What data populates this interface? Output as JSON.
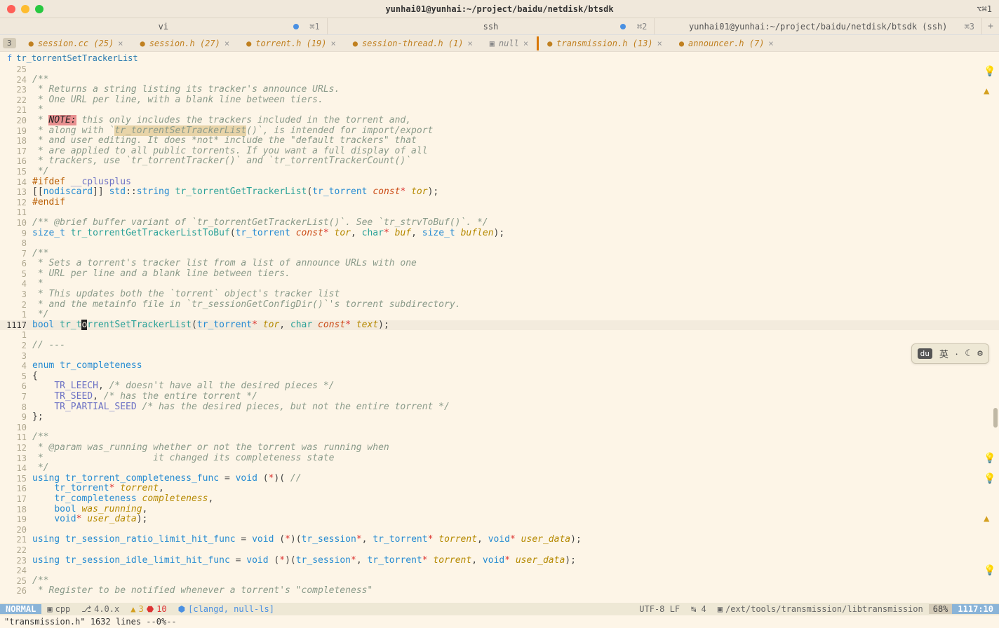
{
  "window": {
    "title": "yunhai01@yunhai:~/project/baidu/netdisk/btsdk",
    "shortcut_right": "⌥⌘1"
  },
  "tmux": [
    {
      "label": "vi",
      "shortcut": "⌘1",
      "activity": true
    },
    {
      "label": "ssh",
      "shortcut": "⌘2",
      "activity": true
    },
    {
      "label": "yunhai01@yunhai:~/project/baidu/netdisk/btsdk (ssh)",
      "shortcut": "⌘3",
      "activity": false
    }
  ],
  "buffers": {
    "count_badge": "3",
    "tabs": [
      {
        "name": "session.cc (25)",
        "modified": true
      },
      {
        "name": "session.h (27)",
        "modified": true
      },
      {
        "name": "torrent.h (19)",
        "modified": true
      },
      {
        "name": "session-thread.h (1)",
        "modified": true
      },
      {
        "name": "null",
        "modified": false,
        "null": true
      },
      {
        "name": "transmission.h (13)",
        "modified": true,
        "active": true
      },
      {
        "name": "announcer.h (7)",
        "modified": true
      }
    ]
  },
  "context": {
    "icon": "f",
    "path": "tr_torrentSetTrackerList"
  },
  "code": [
    {
      "n": "25",
      "t": ""
    },
    {
      "n": "24",
      "t": "/**",
      "cls": "c-comment"
    },
    {
      "n": "23",
      "t": " * Returns a string listing its tracker's announce URLs.",
      "cls": "c-comment"
    },
    {
      "n": "22",
      "t": " * One URL per line, with a blank line between tiers.",
      "cls": "c-comment"
    },
    {
      "n": "21",
      "t": " *",
      "cls": "c-comment"
    },
    {
      "n": "20",
      "html": "<span class='c-comment'> * </span><span class='c-note'>NOTE:</span><span class='c-comment'> this only includes the trackers included in the torrent and,</span>"
    },
    {
      "n": "19",
      "html": "<span class='c-comment'> * along with `</span><span class='c-hl c-comment'>tr_torrentSetTrackerList</span><span class='c-comment'>()`, is intended for import/export</span>"
    },
    {
      "n": "18",
      "t": " * and user editing. It does *not* include the \"default trackers\" that",
      "cls": "c-comment"
    },
    {
      "n": "17",
      "t": " * are applied to all public torrents. If you want a full display of all",
      "cls": "c-comment"
    },
    {
      "n": "16",
      "t": " * trackers, use `tr_torrentTracker()` and `tr_torrentTrackerCount()`",
      "cls": "c-comment"
    },
    {
      "n": "15",
      "t": " */",
      "cls": "c-comment"
    },
    {
      "n": "14",
      "html": "<span class='c-pp'>#ifdef</span> <span class='c-pp2'>__cplusplus</span>"
    },
    {
      "n": "13",
      "html": "[[<span class='c-id'>nodiscard</span>]] <span class='c-type'>std</span>::<span class='c-type'>string</span> <span class='c-fn'>tr_torrentGetTrackerList</span>(<span class='c-type'>tr_torrent</span> <span class='c-const'>const</span><span class='c-ptr'>*</span> <span class='c-param'>tor</span>);"
    },
    {
      "n": "12",
      "html": "<span class='c-pp'>#endif</span>"
    },
    {
      "n": "11",
      "t": ""
    },
    {
      "n": "10",
      "t": "/** @brief buffer variant of `tr_torrentGetTrackerList()`. See `tr_strvToBuf()`. */",
      "cls": "c-comment"
    },
    {
      "n": "9",
      "html": "<span class='c-type'>size_t</span> <span class='c-fn'>tr_torrentGetTrackerListToBuf</span>(<span class='c-type'>tr_torrent</span> <span class='c-const'>const</span><span class='c-ptr'>*</span> <span class='c-param'>tor</span>, <span class='c-char'>char</span><span class='c-ptr'>*</span> <span class='c-param'>buf</span>, <span class='c-type'>size_t</span> <span class='c-param'>buflen</span>);"
    },
    {
      "n": "8",
      "t": ""
    },
    {
      "n": "7",
      "t": "/**",
      "cls": "c-comment"
    },
    {
      "n": "6",
      "t": " * Sets a torrent's tracker list from a list of announce URLs with one",
      "cls": "c-comment"
    },
    {
      "n": "5",
      "t": " * URL per line and a blank line between tiers.",
      "cls": "c-comment"
    },
    {
      "n": "4",
      "t": " *",
      "cls": "c-comment"
    },
    {
      "n": "3",
      "t": " * This updates both the `torrent` object's tracker list",
      "cls": "c-comment"
    },
    {
      "n": "2",
      "t": " * and the metainfo file in `tr_sessionGetConfigDir()`'s torrent subdirectory.",
      "cls": "c-comment"
    },
    {
      "n": "1",
      "t": " */",
      "cls": "c-comment"
    },
    {
      "n": "1117",
      "abs": true,
      "cur": true,
      "html": "<span class='c-type'>bool</span> <span class='c-fn'>tr_t</span><span class='cursor'>o</span><span class='c-fn'>rrentSetTrackerList</span>(<span class='c-type'>tr_torrent</span><span class='c-ptr'>*</span> <span class='c-param'>tor</span>, <span class='c-char'>char</span> <span class='c-const'>const</span><span class='c-ptr'>*</span> <span class='c-param'>text</span>);"
    },
    {
      "n": "1",
      "t": ""
    },
    {
      "n": "2",
      "t": "// ---",
      "cls": "c-comment"
    },
    {
      "n": "3",
      "t": ""
    },
    {
      "n": "4",
      "html": "<span class='c-kw'>enum</span> <span class='c-type'>tr_completeness</span>"
    },
    {
      "n": "5",
      "t": "{"
    },
    {
      "n": "6",
      "html": "    <span class='c-enum'>TR_LEECH</span>, <span class='c-comment'>/* doesn't have all the desired pieces */</span>"
    },
    {
      "n": "7",
      "html": "    <span class='c-enum'>TR_SEED</span>, <span class='c-comment'>/* has the entire torrent */</span>"
    },
    {
      "n": "8",
      "html": "    <span class='c-enum'>TR_PARTIAL_SEED</span> <span class='c-comment'>/* has the desired pieces, but not the entire torrent */</span>"
    },
    {
      "n": "9",
      "t": "};"
    },
    {
      "n": "10",
      "t": ""
    },
    {
      "n": "11",
      "t": "/**",
      "cls": "c-comment"
    },
    {
      "n": "12",
      "t": " * @param was_running whether or not the torrent was running when",
      "cls": "c-comment"
    },
    {
      "n": "13",
      "t": " *                    it changed its completeness state",
      "cls": "c-comment"
    },
    {
      "n": "14",
      "t": " */",
      "cls": "c-comment"
    },
    {
      "n": "15",
      "html": "<span class='c-kw'>using</span> <span class='c-type'>tr_torrent_completeness_func</span> = <span class='c-type'>void</span> (<span class='c-ptr'>*</span>)( <span class='c-comment'>//</span>"
    },
    {
      "n": "16",
      "html": "    <span class='c-type'>tr_torrent</span><span class='c-ptr'>*</span> <span class='c-param'>torrent</span>,"
    },
    {
      "n": "17",
      "html": "    <span class='c-type'>tr_completeness</span> <span class='c-param'>completeness</span>,"
    },
    {
      "n": "18",
      "html": "    <span class='c-type'>bool</span> <span class='c-param'>was_running</span>,"
    },
    {
      "n": "19",
      "html": "    <span class='c-type'>void</span><span class='c-ptr'>*</span> <span class='c-param'>user_data</span>);"
    },
    {
      "n": "20",
      "t": ""
    },
    {
      "n": "21",
      "html": "<span class='c-kw'>using</span> <span class='c-type'>tr_session_ratio_limit_hit_func</span> = <span class='c-type'>void</span> (<span class='c-ptr'>*</span>)(<span class='c-type'>tr_session</span><span class='c-ptr'>*</span>, <span class='c-type'>tr_torrent</span><span class='c-ptr'>*</span> <span class='c-param'>torrent</span>, <span class='c-type'>void</span><span class='c-ptr'>*</span> <span class='c-param'>user_data</span>);"
    },
    {
      "n": "22",
      "t": ""
    },
    {
      "n": "23",
      "html": "<span class='c-kw'>using</span> <span class='c-type'>tr_session_idle_limit_hit_func</span> = <span class='c-type'>void</span> (<span class='c-ptr'>*</span>)(<span class='c-type'>tr_session</span><span class='c-ptr'>*</span>, <span class='c-type'>tr_torrent</span><span class='c-ptr'>*</span> <span class='c-param'>torrent</span>, <span class='c-type'>void</span><span class='c-ptr'>*</span> <span class='c-param'>user_data</span>);"
    },
    {
      "n": "24",
      "t": ""
    },
    {
      "n": "25",
      "t": "/**",
      "cls": "c-comment"
    },
    {
      "n": "26",
      "t": " * Register to be notified whenever a torrent's \"completeness\"",
      "cls": "c-comment"
    }
  ],
  "float": {
    "items": [
      "du",
      "英",
      "⸱",
      "☾",
      "⚙"
    ]
  },
  "status": {
    "mode": "NORMAL",
    "filetype": "cpp",
    "branch": "4.0.x",
    "warn": "3",
    "err": "10",
    "lsp": "[clangd, null-ls]",
    "encoding": "UTF-8 LF",
    "indent": "↹ 4",
    "path": "/ext/tools/transmission/libtransmission",
    "percent": "68%",
    "position": "1117:10"
  },
  "cmdline": "\"transmission.h\" 1632 lines --0%--"
}
